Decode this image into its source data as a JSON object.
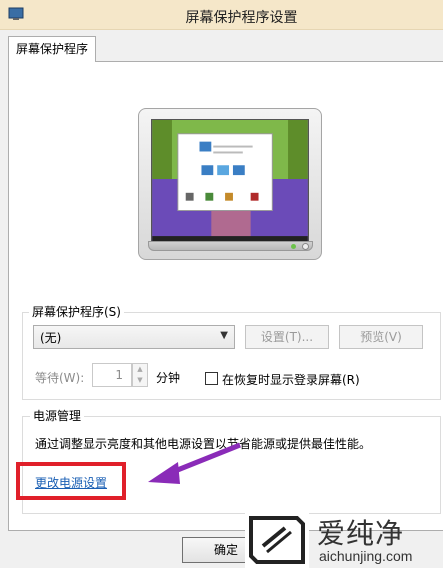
{
  "window": {
    "title": "屏幕保护程序设置"
  },
  "tab": {
    "label": "屏幕保护程序"
  },
  "screensaver_group": {
    "label": "屏幕保护程序(S)",
    "selected": "(无)",
    "settings_btn": "设置(T)...",
    "preview_btn": "预览(V)",
    "wait_label": "等待(W):",
    "wait_value": "1",
    "wait_unit": "分钟",
    "resume_checkbox_label": "在恢复时显示登录屏幕(R)",
    "resume_checked": false
  },
  "power_group": {
    "label": "电源管理",
    "description": "通过调整显示亮度和其他电源设置以节省能源或提供最佳性能。",
    "link": "更改电源设置"
  },
  "footer": {
    "ok_btn": "确定"
  },
  "watermark": {
    "brand": "爱纯净",
    "domain": "aichunjing.com"
  },
  "colors": {
    "highlight": "#e0202a",
    "arrow": "#8a2bb8",
    "link": "#1a5fb4",
    "titlebar": "#f5e7c9"
  }
}
